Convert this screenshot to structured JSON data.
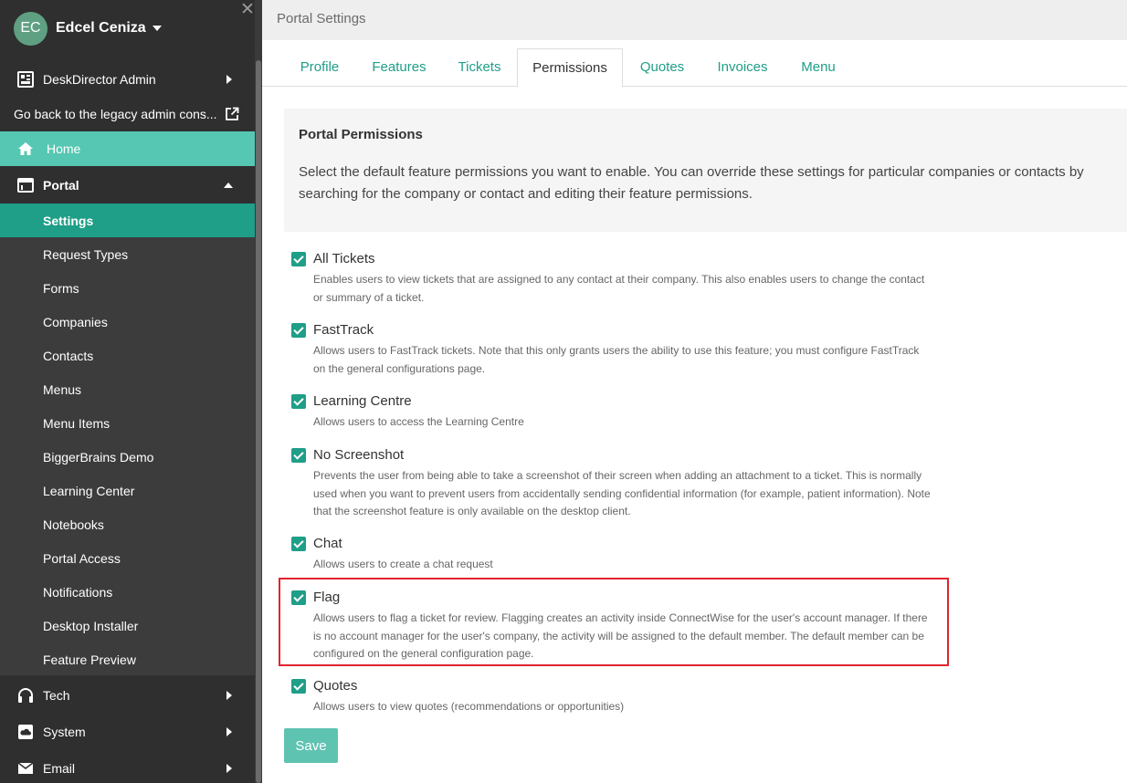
{
  "sidebar": {
    "user": {
      "initials": "EC",
      "name": "Edcel Ceniza"
    },
    "admin_label": "DeskDirector Admin",
    "legacy_label": "Go back to the legacy admin cons...",
    "home_label": "Home",
    "portal_label": "Portal",
    "portal_items": [
      "Settings",
      "Request Types",
      "Forms",
      "Companies",
      "Contacts",
      "Menus",
      "Menu Items",
      "BiggerBrains Demo",
      "Learning Center",
      "Notebooks",
      "Portal Access",
      "Notifications",
      "Desktop Installer",
      "Feature Preview"
    ],
    "tech_label": "Tech",
    "system_label": "System",
    "email_label": "Email"
  },
  "header": {
    "title": "Portal Settings"
  },
  "tabs": [
    "Profile",
    "Features",
    "Tickets",
    "Permissions",
    "Quotes",
    "Invoices",
    "Menu"
  ],
  "info": {
    "heading": "Portal Permissions",
    "text": "Select the default feature permissions you want to enable. You can override these settings for particular companies or contacts by searching for the company or contact and editing their feature permissions."
  },
  "permissions": [
    {
      "name": "All Tickets",
      "checked": true,
      "desc": "Enables users to view tickets that are assigned to any contact at their company. This also enables users to change the contact or summary of a ticket."
    },
    {
      "name": "FastTrack",
      "checked": true,
      "desc": "Allows users to FastTrack tickets. Note that this only grants users the ability to use this feature; you must configure FastTrack on the general configurations page."
    },
    {
      "name": "Learning Centre",
      "checked": true,
      "desc": "Allows users to access the Learning Centre"
    },
    {
      "name": "No Screenshot",
      "checked": true,
      "desc": "Prevents the user from being able to take a screenshot of their screen when adding an attachment to a ticket. This is normally used when you want to prevent users from accidentally sending confidential information (for example, patient information). Note that the screenshot feature is only available on the desktop client."
    },
    {
      "name": "Chat",
      "checked": true,
      "desc": "Allows users to create a chat request"
    },
    {
      "name": "Flag",
      "checked": true,
      "desc": "Allows users to flag a ticket for review. Flagging creates an activity inside ConnectWise for the user's account manager. If there is no account manager for the user's company, the activity will be assigned to the default member. The default member can be configured on the general configuration page."
    },
    {
      "name": "Quotes",
      "checked": true,
      "desc": "Allows users to view quotes (recommendations or opportunities)"
    }
  ],
  "save_label": "Save",
  "colors": {
    "accent": "#1f9e88",
    "sidebar_bg": "#2f2f2f",
    "home_bg": "#56c7b3",
    "highlight": "#e0242f"
  }
}
